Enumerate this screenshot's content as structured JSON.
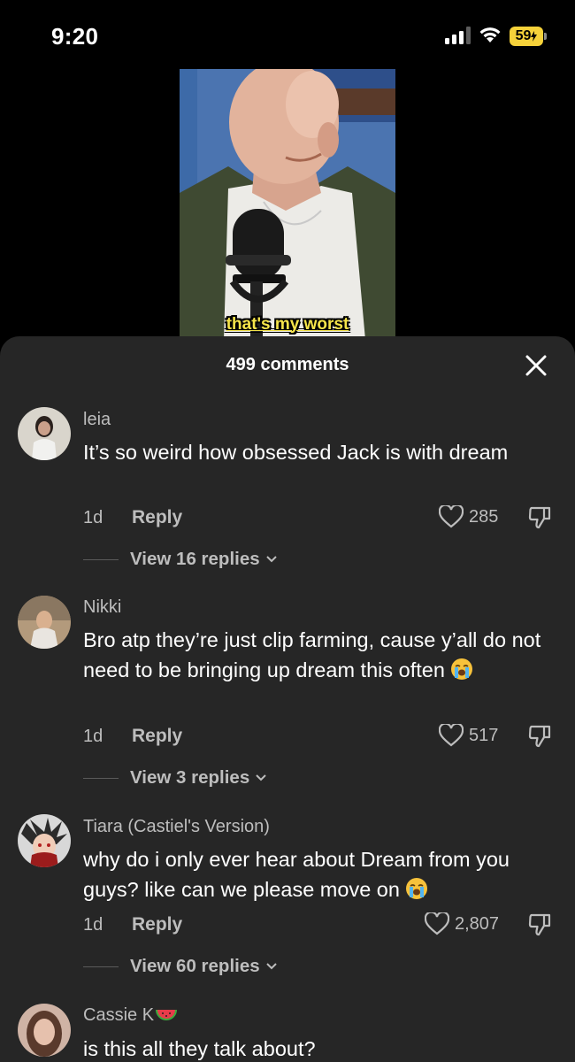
{
  "status_bar": {
    "time": "9:20",
    "battery": "59",
    "icons": [
      "signal-bars-icon",
      "wifi-icon",
      "battery-charging-icon"
    ]
  },
  "video": {
    "caption": "that's my worst"
  },
  "comments_sheet": {
    "title": "499 comments",
    "close_icon": "close-icon",
    "comments": [
      {
        "username": "leia",
        "text": "It’s so weird how obsessed Jack is with dream",
        "time": "1d",
        "reply_label": "Reply",
        "likes": "285",
        "view_replies": "View 16 replies"
      },
      {
        "username": "Nikki",
        "text": "Bro atp they’re just clip farming, cause y’all do not need to be bringing up dream this often",
        "emoji": "loudly-crying-face",
        "time": "1d",
        "reply_label": "Reply",
        "likes": "517",
        "view_replies": "View 3 replies"
      },
      {
        "username": "Tiara (Castiel's Version)",
        "text": "why do i only ever hear about Dream from you guys? like can we please move on",
        "emoji": "loudly-crying-face",
        "time": "1d",
        "reply_label": "Reply",
        "likes": "2,807",
        "view_replies": "View 60 replies"
      },
      {
        "username": "Cassie K",
        "username_emoji": "watermelon",
        "text": "is this all they talk about?"
      }
    ]
  },
  "colors": {
    "sheet_background": "#262626",
    "secondary_text": "#bdbdbd",
    "caption_yellow": "#f5e44a",
    "battery_yellow": "#f6d23a"
  }
}
